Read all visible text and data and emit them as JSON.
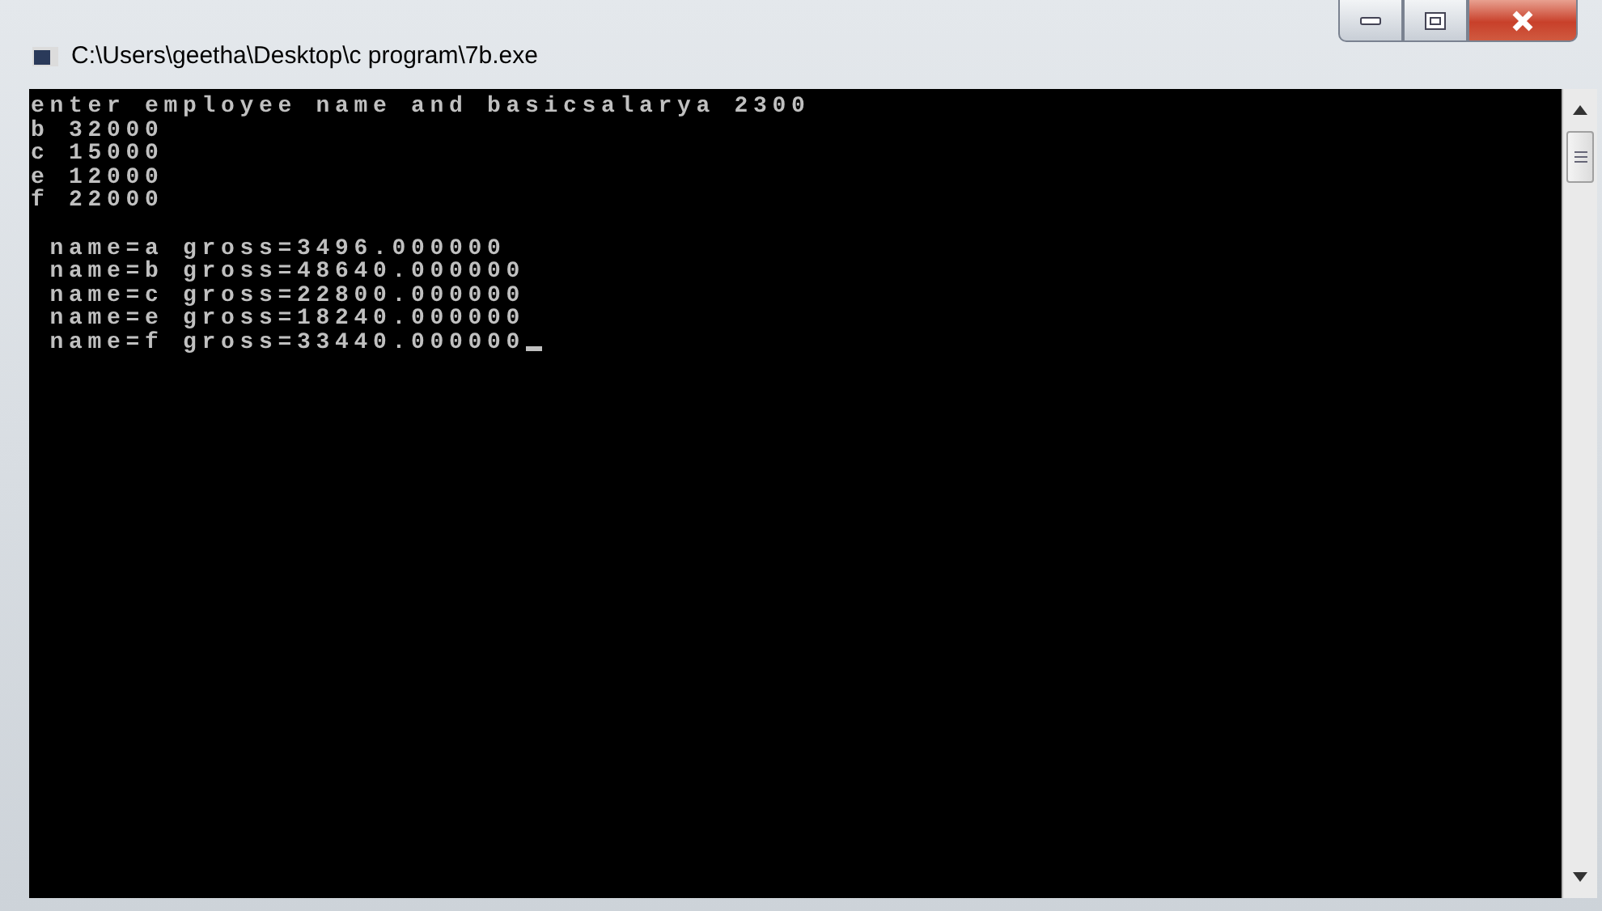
{
  "window": {
    "title": "C:\\Users\\geetha\\Desktop\\c program\\7b.exe"
  },
  "console": {
    "input_lines": [
      "enter employee name and basicsalarya 2300",
      "b 32000",
      "c 15000",
      "e 12000",
      "f 22000"
    ],
    "output_lines": [
      " name=a gross=3496.000000",
      " name=b gross=48640.000000",
      " name=c gross=22800.000000",
      " name=e gross=18240.000000",
      " name=f gross=33440.000000"
    ],
    "cursor": true
  }
}
